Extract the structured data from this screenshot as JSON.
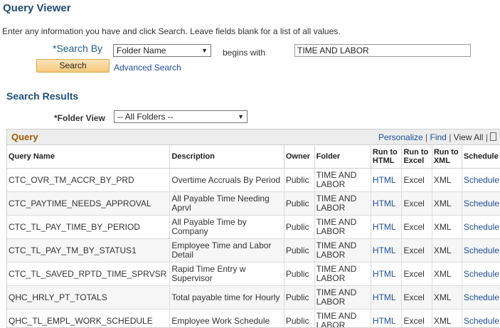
{
  "page": {
    "title": "Query Viewer",
    "instructions": "Enter any information you have and click Search. Leave fields blank for a list of all values."
  },
  "search": {
    "search_by_label": "*Search By",
    "search_by_value": "Folder Name",
    "operator": "begins with",
    "value": "TIME AND LABOR",
    "search_button": "Search",
    "advanced_link": "Advanced Search"
  },
  "results": {
    "title": "Search Results",
    "folder_view_label": "*Folder View",
    "folder_view_value": "-- All Folders --"
  },
  "grid": {
    "caption": "Query",
    "personalize": "Personalize",
    "find": "Find",
    "view_all": "View All",
    "separator": "|",
    "columns": {
      "query_name": "Query Name",
      "description": "Description",
      "owner": "Owner",
      "folder": "Folder",
      "run_html": "Run to HTML",
      "run_excel": "Run to Excel",
      "run_xml": "Run to XML",
      "schedule": "Schedule"
    },
    "rows": [
      {
        "name": "CTC_OVR_TM_ACCR_BY_PRD",
        "description": "Overtime Accruals By Period",
        "owner": "Public",
        "folder": "TIME AND LABOR",
        "html": "HTML",
        "excel": "Excel",
        "xml": "XML",
        "schedule": "Schedule"
      },
      {
        "name": "CTC_PAYTIME_NEEDS_APPROVAL",
        "description": "All Payable Time Needing Aprvl",
        "owner": "Public",
        "folder": "TIME AND LABOR",
        "html": "HTML",
        "excel": "Excel",
        "xml": "XML",
        "schedule": "Schedule"
      },
      {
        "name": "CTC_TL_PAY_TIME_BY_PERIOD",
        "description": "All Payable Time by Company",
        "owner": "Public",
        "folder": "TIME AND LABOR",
        "html": "HTML",
        "excel": "Excel",
        "xml": "XML",
        "schedule": "Schedule"
      },
      {
        "name": "CTC_TL_PAY_TM_BY_STATUS1",
        "description": "Employee Time and Labor Detail",
        "owner": "Public",
        "folder": "TIME AND LABOR",
        "html": "HTML",
        "excel": "Excel",
        "xml": "XML",
        "schedule": "Schedule"
      },
      {
        "name": "CTC_TL_SAVED_RPTD_TIME_SPRVSR",
        "description": "Rapid Time Entry w Supervisor",
        "owner": "Public",
        "folder": "TIME AND LABOR",
        "html": "HTML",
        "excel": "Excel",
        "xml": "XML",
        "schedule": "Schedule"
      },
      {
        "name": "QHC_HRLY_PT_TOTALS",
        "description": "Total payable time for Hourly",
        "owner": "Public",
        "folder": "TIME AND LABOR",
        "html": "HTML",
        "excel": "Excel",
        "xml": "XML",
        "schedule": "Schedule"
      },
      {
        "name": "QHC_TL_EMPL_WORK_SCHEDULE",
        "description": "Employee Work Schedule",
        "owner": "Public",
        "folder": "TIME AND LABOR",
        "html": "HTML",
        "excel": "Excel",
        "xml": "XML",
        "schedule": "Schedule"
      }
    ]
  },
  "icons": {
    "dropdown": "chevron-down-icon",
    "find": "find-icon"
  },
  "colors": {
    "title": "#1f4e79",
    "link": "#1f4e99",
    "caption": "#a35a00",
    "button": "#f5c879"
  }
}
